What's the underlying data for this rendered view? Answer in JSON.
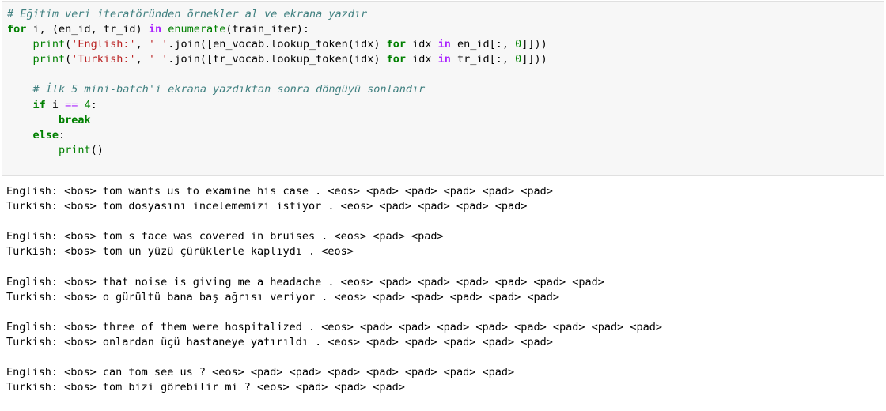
{
  "code_cell": {
    "lines": [
      [
        {
          "t": "# Eğitim veri iteratöründen örnekler al ve ekrana yazdır",
          "c": "comment"
        }
      ],
      [
        {
          "t": "for",
          "c": "kw"
        },
        {
          "t": " i, (en_id, tr_id) ",
          "c": "name"
        },
        {
          "t": "in",
          "c": "kw-op"
        },
        {
          "t": " ",
          "c": "name"
        },
        {
          "t": "enumerate",
          "c": "builtin"
        },
        {
          "t": "(train_iter):",
          "c": "name"
        }
      ],
      [
        {
          "t": "    ",
          "c": "name"
        },
        {
          "t": "print",
          "c": "builtin"
        },
        {
          "t": "(",
          "c": "name"
        },
        {
          "t": "'English:'",
          "c": "str"
        },
        {
          "t": ", ",
          "c": "name"
        },
        {
          "t": "' '",
          "c": "str"
        },
        {
          "t": ".join([en_vocab.lookup_token(idx) ",
          "c": "name"
        },
        {
          "t": "for",
          "c": "kw"
        },
        {
          "t": " idx ",
          "c": "name"
        },
        {
          "t": "in",
          "c": "kw-op"
        },
        {
          "t": " en_id[:, ",
          "c": "name"
        },
        {
          "t": "0",
          "c": "num"
        },
        {
          "t": "]]))",
          "c": "name"
        }
      ],
      [
        {
          "t": "    ",
          "c": "name"
        },
        {
          "t": "print",
          "c": "builtin"
        },
        {
          "t": "(",
          "c": "name"
        },
        {
          "t": "'Turkish:'",
          "c": "str"
        },
        {
          "t": ", ",
          "c": "name"
        },
        {
          "t": "' '",
          "c": "str"
        },
        {
          "t": ".join([tr_vocab.lookup_token(idx) ",
          "c": "name"
        },
        {
          "t": "for",
          "c": "kw"
        },
        {
          "t": " idx ",
          "c": "name"
        },
        {
          "t": "in",
          "c": "kw-op"
        },
        {
          "t": " tr_id[:, ",
          "c": "name"
        },
        {
          "t": "0",
          "c": "num"
        },
        {
          "t": "]]))",
          "c": "name"
        }
      ],
      [],
      [
        {
          "t": "    ",
          "c": "name"
        },
        {
          "t": "# İlk 5 mini-batch'i ekrana yazdıktan sonra döngüyü sonlandır",
          "c": "comment"
        }
      ],
      [
        {
          "t": "    ",
          "c": "name"
        },
        {
          "t": "if",
          "c": "kw"
        },
        {
          "t": " i ",
          "c": "name"
        },
        {
          "t": "==",
          "c": "op"
        },
        {
          "t": " ",
          "c": "name"
        },
        {
          "t": "4",
          "c": "num"
        },
        {
          "t": ":",
          "c": "name"
        }
      ],
      [
        {
          "t": "        ",
          "c": "name"
        },
        {
          "t": "break",
          "c": "kw"
        }
      ],
      [
        {
          "t": "    ",
          "c": "name"
        },
        {
          "t": "else",
          "c": "kw"
        },
        {
          "t": ":",
          "c": "name"
        }
      ],
      [
        {
          "t": "        ",
          "c": "name"
        },
        {
          "t": "print",
          "c": "builtin"
        },
        {
          "t": "()",
          "c": "name"
        }
      ]
    ]
  },
  "output": {
    "lines": [
      "English: <bos> tom wants us to examine his case . <eos> <pad> <pad> <pad> <pad> <pad>",
      "Turkish: <bos> tom dosyasını incelememizi istiyor . <eos> <pad> <pad> <pad> <pad>",
      "",
      "English: <bos> tom s face was covered in bruises . <eos> <pad> <pad>",
      "Turkish: <bos> tom un yüzü çürüklerle kaplıydı . <eos>",
      "",
      "English: <bos> that noise is giving me a headache . <eos> <pad> <pad> <pad> <pad> <pad> <pad>",
      "Turkish: <bos> o gürültü bana baş ağrısı veriyor . <eos> <pad> <pad> <pad> <pad> <pad>",
      "",
      "English: <bos> three of them were hospitalized . <eos> <pad> <pad> <pad> <pad> <pad> <pad> <pad> <pad>",
      "Turkish: <bos> onlardan üçü hastaneye yatırıldı . <eos> <pad> <pad> <pad> <pad> <pad>",
      "",
      "English: <bos> can tom see us ? <eos> <pad> <pad> <pad> <pad> <pad> <pad> <pad>",
      "Turkish: <bos> tom bizi görebilir mi ? <eos> <pad> <pad> <pad>"
    ]
  }
}
